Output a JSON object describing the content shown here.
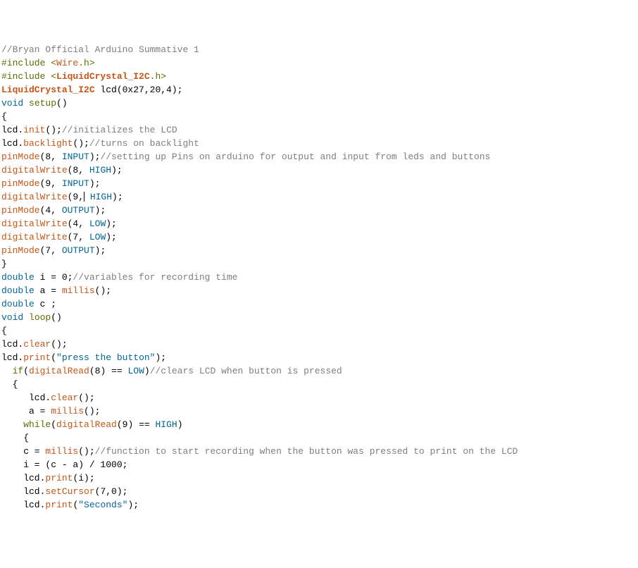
{
  "code": {
    "tokens": [
      [
        {
          "t": "//Bryan Official Arduino Summative 1",
          "c": "comment"
        }
      ],
      [
        {
          "t": "#include <",
          "c": "preproc"
        },
        {
          "t": "Wire",
          "c": "func"
        },
        {
          "t": ".h>",
          "c": "preproc"
        }
      ],
      [
        {
          "t": "#include <",
          "c": "preproc"
        },
        {
          "t": "LiquidCrystal_I2C",
          "c": "bold-type"
        },
        {
          "t": ".h>",
          "c": "preproc"
        }
      ],
      [
        {
          "t": "LiquidCrystal_I2C",
          "c": "bold-type"
        },
        {
          "t": " lcd(0x27,20,4);",
          "c": ""
        }
      ],
      [
        {
          "t": "void",
          "c": "type"
        },
        {
          "t": " ",
          "c": ""
        },
        {
          "t": "setup",
          "c": "keyword"
        },
        {
          "t": "()",
          "c": ""
        }
      ],
      [
        {
          "t": "{",
          "c": ""
        }
      ],
      [
        {
          "t": "lcd.",
          "c": ""
        },
        {
          "t": "init",
          "c": "func"
        },
        {
          "t": "();",
          "c": ""
        },
        {
          "t": "//initializes the LCD",
          "c": "comment"
        }
      ],
      [
        {
          "t": "lcd.",
          "c": ""
        },
        {
          "t": "backlight",
          "c": "func"
        },
        {
          "t": "();",
          "c": ""
        },
        {
          "t": "//turns on backlight",
          "c": "comment"
        }
      ],
      [
        {
          "t": "pinMode",
          "c": "func"
        },
        {
          "t": "(8, ",
          "c": ""
        },
        {
          "t": "INPUT",
          "c": "type"
        },
        {
          "t": ");",
          "c": ""
        },
        {
          "t": "//setting up Pins on arduino for output and input from leds and buttons",
          "c": "comment"
        }
      ],
      [
        {
          "t": "digitalWrite",
          "c": "func"
        },
        {
          "t": "(8, ",
          "c": ""
        },
        {
          "t": "HIGH",
          "c": "type"
        },
        {
          "t": ");",
          "c": ""
        }
      ],
      [
        {
          "t": "pinMode",
          "c": "func"
        },
        {
          "t": "(9, ",
          "c": ""
        },
        {
          "t": "INPUT",
          "c": "type"
        },
        {
          "t": ");",
          "c": ""
        }
      ],
      [
        {
          "t": "digitalWrite",
          "c": "func"
        },
        {
          "t": "(9,",
          "c": ""
        },
        {
          "t": "",
          "c": "",
          "cursor": true
        },
        {
          "t": " HIGH",
          "c": "type"
        },
        {
          "t": ");",
          "c": ""
        }
      ],
      [
        {
          "t": "pinMode",
          "c": "func"
        },
        {
          "t": "(4, ",
          "c": ""
        },
        {
          "t": "OUTPUT",
          "c": "type"
        },
        {
          "t": ");",
          "c": ""
        }
      ],
      [
        {
          "t": "digitalWrite",
          "c": "func"
        },
        {
          "t": "(4, ",
          "c": ""
        },
        {
          "t": "LOW",
          "c": "type"
        },
        {
          "t": ");",
          "c": ""
        }
      ],
      [
        {
          "t": "digitalWrite",
          "c": "func"
        },
        {
          "t": "(7, ",
          "c": ""
        },
        {
          "t": "LOW",
          "c": "type"
        },
        {
          "t": ");",
          "c": ""
        }
      ],
      [
        {
          "t": "pinMode",
          "c": "func"
        },
        {
          "t": "(7, ",
          "c": ""
        },
        {
          "t": "OUTPUT",
          "c": "type"
        },
        {
          "t": ");",
          "c": ""
        }
      ],
      [
        {
          "t": "}",
          "c": ""
        }
      ],
      [
        {
          "t": "double",
          "c": "type"
        },
        {
          "t": " i = 0;",
          "c": ""
        },
        {
          "t": "//variables for recording time",
          "c": "comment"
        }
      ],
      [
        {
          "t": "double",
          "c": "type"
        },
        {
          "t": " a = ",
          "c": ""
        },
        {
          "t": "millis",
          "c": "func"
        },
        {
          "t": "();",
          "c": ""
        }
      ],
      [
        {
          "t": "double",
          "c": "type"
        },
        {
          "t": " c ;",
          "c": ""
        }
      ],
      [
        {
          "t": "void",
          "c": "type"
        },
        {
          "t": " ",
          "c": ""
        },
        {
          "t": "loop",
          "c": "keyword"
        },
        {
          "t": "()",
          "c": ""
        }
      ],
      [
        {
          "t": "{",
          "c": ""
        }
      ],
      [
        {
          "t": "lcd.",
          "c": ""
        },
        {
          "t": "clear",
          "c": "func"
        },
        {
          "t": "();",
          "c": ""
        }
      ],
      [
        {
          "t": "lcd.",
          "c": ""
        },
        {
          "t": "print",
          "c": "func"
        },
        {
          "t": "(",
          "c": ""
        },
        {
          "t": "\"press the button\"",
          "c": "string"
        },
        {
          "t": ");",
          "c": ""
        }
      ],
      [
        {
          "t": "",
          "c": ""
        }
      ],
      [
        {
          "t": "  ",
          "c": ""
        },
        {
          "t": "if",
          "c": "keyword"
        },
        {
          "t": "(",
          "c": ""
        },
        {
          "t": "digitalRead",
          "c": "func"
        },
        {
          "t": "(8) == ",
          "c": ""
        },
        {
          "t": "LOW",
          "c": "type"
        },
        {
          "t": ")",
          "c": ""
        },
        {
          "t": "//clears LCD when button is pressed",
          "c": "comment"
        }
      ],
      [
        {
          "t": "  {",
          "c": ""
        }
      ],
      [
        {
          "t": "     lcd.",
          "c": ""
        },
        {
          "t": "clear",
          "c": "func"
        },
        {
          "t": "();",
          "c": ""
        }
      ],
      [
        {
          "t": "     a = ",
          "c": ""
        },
        {
          "t": "millis",
          "c": "func"
        },
        {
          "t": "();",
          "c": ""
        }
      ],
      [
        {
          "t": "",
          "c": ""
        }
      ],
      [
        {
          "t": "    ",
          "c": ""
        },
        {
          "t": "while",
          "c": "keyword"
        },
        {
          "t": "(",
          "c": ""
        },
        {
          "t": "digitalRead",
          "c": "func"
        },
        {
          "t": "(9) == ",
          "c": ""
        },
        {
          "t": "HIGH",
          "c": "type"
        },
        {
          "t": ")",
          "c": ""
        }
      ],
      [
        {
          "t": "    {",
          "c": ""
        }
      ],
      [
        {
          "t": "    c = ",
          "c": ""
        },
        {
          "t": "millis",
          "c": "func"
        },
        {
          "t": "();",
          "c": ""
        },
        {
          "t": "//function to start recording when the button was pressed to print on the LCD",
          "c": "comment"
        }
      ],
      [
        {
          "t": "    i = (c - a) / 1000;",
          "c": ""
        }
      ],
      [
        {
          "t": "    lcd.",
          "c": ""
        },
        {
          "t": "print",
          "c": "func"
        },
        {
          "t": "(i);",
          "c": ""
        }
      ],
      [
        {
          "t": "    lcd.",
          "c": ""
        },
        {
          "t": "setCursor",
          "c": "func"
        },
        {
          "t": "(7,0);",
          "c": ""
        }
      ],
      [
        {
          "t": "    lcd.",
          "c": ""
        },
        {
          "t": "print",
          "c": "func"
        },
        {
          "t": "(",
          "c": ""
        },
        {
          "t": "\"Seconds\"",
          "c": "string"
        },
        {
          "t": ");",
          "c": ""
        }
      ]
    ]
  }
}
